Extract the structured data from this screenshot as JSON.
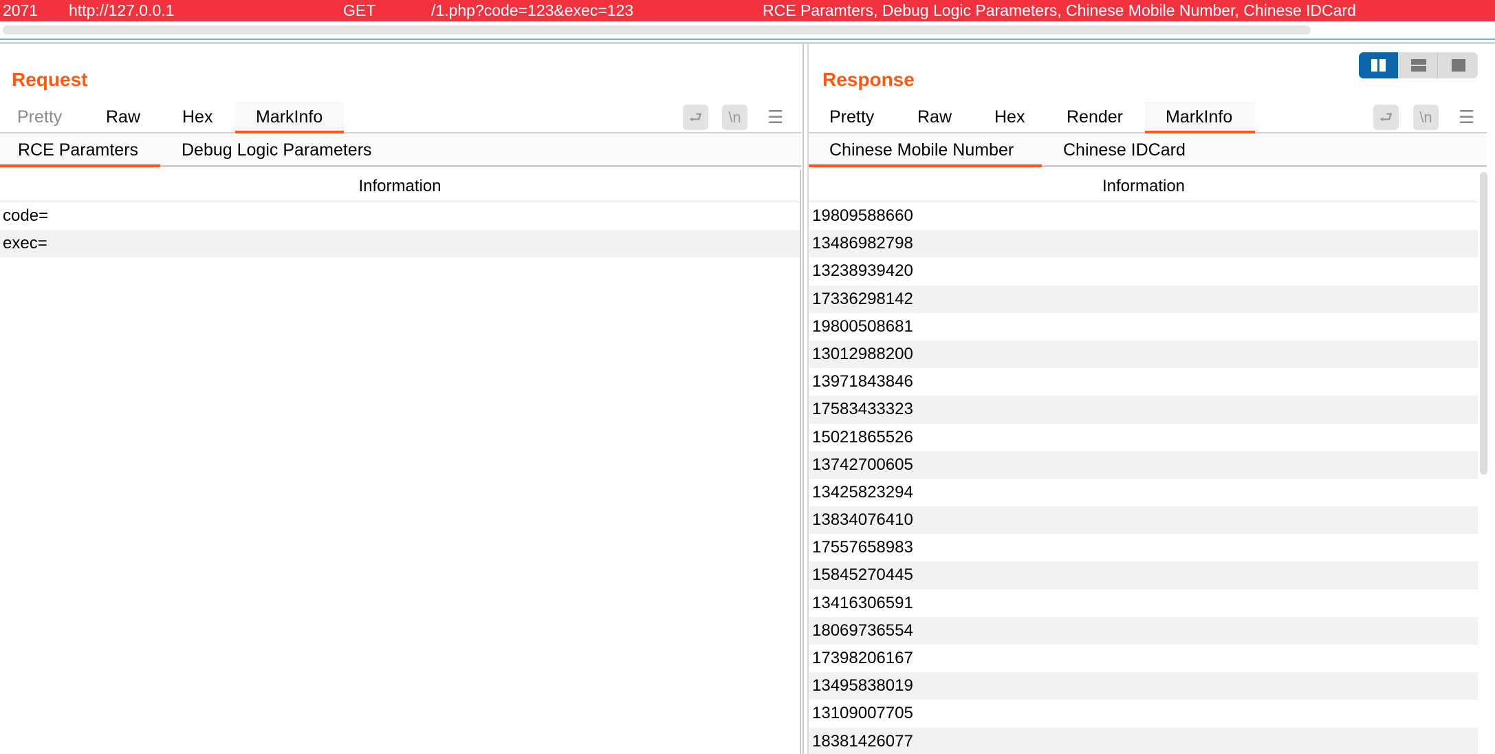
{
  "topbar": {
    "id": "2071",
    "host": "http://127.0.0.1",
    "method": "GET",
    "path": "/1.php?code=123&exec=123",
    "tags": "RCE Paramters, Debug Logic Parameters, Chinese Mobile Number, Chinese IDCard",
    "color": "#f2323f"
  },
  "accent_color": "#ff5a14",
  "request": {
    "title": "Request",
    "tabs": [
      "Pretty",
      "Raw",
      "Hex",
      "MarkInfo"
    ],
    "active_tab": "MarkInfo",
    "subtabs": [
      "RCE Paramters",
      "Debug Logic Parameters"
    ],
    "active_subtab": "RCE Paramters",
    "table_header": "Information",
    "rows": [
      "code=",
      "exec="
    ],
    "icons": [
      "wrap-icon",
      "newline-icon",
      "menu-icon"
    ],
    "newline_label": "\\n"
  },
  "response": {
    "title": "Response",
    "tabs": [
      "Pretty",
      "Raw",
      "Hex",
      "Render",
      "MarkInfo"
    ],
    "active_tab": "MarkInfo",
    "subtabs": [
      "Chinese Mobile Number",
      "Chinese IDCard"
    ],
    "active_subtab": "Chinese Mobile Number",
    "table_header": "Information",
    "rows": [
      "19809588660",
      "13486982798",
      "13238939420",
      "17336298142",
      "19800508681",
      "13012988200",
      "13971843846",
      "17583433323",
      "15021865526",
      "13742700605",
      "13425823294",
      "13834076410",
      "17557658983",
      "15845270445",
      "13416306591",
      "18069736554",
      "17398206167",
      "13495838019",
      "13109007705",
      "18381426077"
    ],
    "icons": [
      "wrap-icon",
      "newline-icon",
      "menu-icon"
    ],
    "newline_label": "\\n"
  },
  "layout_toggle": {
    "options": [
      "side-by-side",
      "stacked",
      "single"
    ],
    "active": "side-by-side",
    "active_color": "#0a66a8"
  }
}
